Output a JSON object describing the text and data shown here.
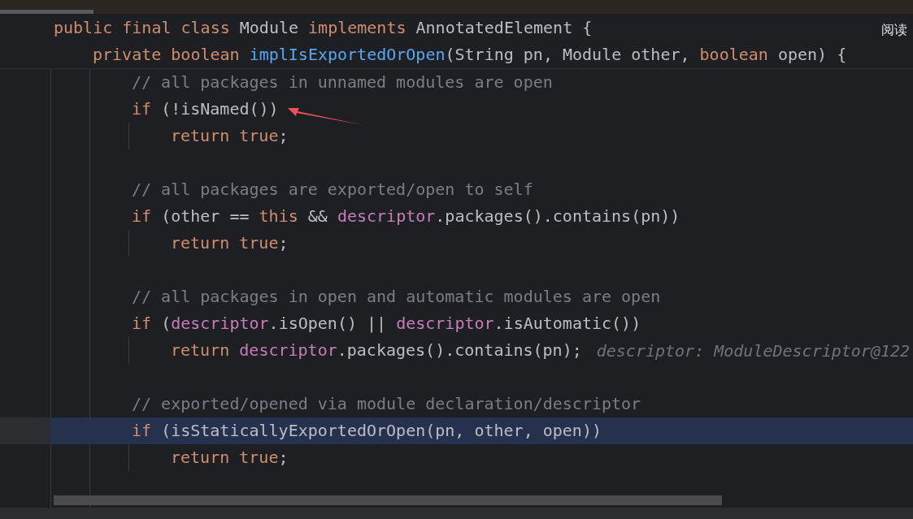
{
  "floating_label": "阅读",
  "sticky_header": [
    {
      "kind": "class",
      "tokens": [
        {
          "kind": "keyword",
          "text": "public final class "
        },
        {
          "kind": "plain",
          "text": "Module "
        },
        {
          "kind": "keyword",
          "text": "implements "
        },
        {
          "kind": "plain",
          "text": "AnnotatedElement {"
        }
      ]
    },
    {
      "kind": "member",
      "tokens": [
        {
          "kind": "keyword",
          "text": "private boolean "
        },
        {
          "kind": "declaration",
          "text": "implIsExportedOrOpen"
        },
        {
          "kind": "plain",
          "text": "(String pn, Module other, "
        },
        {
          "kind": "keyword",
          "text": "boolean "
        },
        {
          "kind": "plain",
          "text": "open) {"
        }
      ]
    }
  ],
  "lines": [
    {
      "highlighted": false,
      "kind": "statement",
      "tokens": [
        {
          "kind": "comment",
          "text": "// all packages in unnamed modules are open"
        }
      ]
    },
    {
      "highlighted": false,
      "kind": "statement",
      "tokens": [
        {
          "kind": "keyword",
          "text": "if "
        },
        {
          "kind": "plain",
          "text": "(!isNamed())"
        }
      ]
    },
    {
      "highlighted": false,
      "kind": "nested",
      "tokens": [
        {
          "kind": "keyword",
          "text": "return true"
        },
        {
          "kind": "plain",
          "text": ";"
        }
      ]
    },
    {
      "highlighted": false,
      "kind": "blank"
    },
    {
      "highlighted": false,
      "kind": "statement",
      "tokens": [
        {
          "kind": "comment",
          "text": "// all packages are exported/open to self"
        }
      ]
    },
    {
      "highlighted": false,
      "kind": "statement",
      "tokens": [
        {
          "kind": "keyword",
          "text": "if "
        },
        {
          "kind": "plain",
          "text": "(other == "
        },
        {
          "kind": "keyword",
          "text": "this "
        },
        {
          "kind": "plain",
          "text": "&& "
        },
        {
          "kind": "field",
          "text": "descriptor"
        },
        {
          "kind": "plain",
          "text": ".packages().contains(pn))"
        }
      ]
    },
    {
      "highlighted": false,
      "kind": "nested",
      "tokens": [
        {
          "kind": "keyword",
          "text": "return true"
        },
        {
          "kind": "plain",
          "text": ";"
        }
      ]
    },
    {
      "highlighted": false,
      "kind": "blank"
    },
    {
      "highlighted": false,
      "kind": "statement",
      "tokens": [
        {
          "kind": "comment",
          "text": "// all packages in open and automatic modules are open"
        }
      ]
    },
    {
      "highlighted": false,
      "kind": "statement",
      "tokens": [
        {
          "kind": "keyword",
          "text": "if "
        },
        {
          "kind": "plain",
          "text": "("
        },
        {
          "kind": "field",
          "text": "descriptor"
        },
        {
          "kind": "plain",
          "text": ".isOpen() || "
        },
        {
          "kind": "field",
          "text": "descriptor"
        },
        {
          "kind": "plain",
          "text": ".isAutomatic())"
        }
      ]
    },
    {
      "highlighted": false,
      "kind": "nested",
      "tokens": [
        {
          "kind": "keyword",
          "text": "return "
        },
        {
          "kind": "field",
          "text": "descriptor"
        },
        {
          "kind": "plain",
          "text": ".packages().contains(pn);"
        }
      ],
      "hint": "descriptor: ModuleDescriptor@122"
    },
    {
      "highlighted": false,
      "kind": "blank"
    },
    {
      "highlighted": false,
      "kind": "statement",
      "tokens": [
        {
          "kind": "comment",
          "text": "// exported/opened via module declaration/descriptor"
        }
      ]
    },
    {
      "highlighted": true,
      "kind": "statement",
      "tokens": [
        {
          "kind": "keyword",
          "text": "if "
        },
        {
          "kind": "plain",
          "text": "(isStaticallyExportedOrOpen(pn, other, open))"
        }
      ]
    },
    {
      "highlighted": false,
      "kind": "nested",
      "tokens": [
        {
          "kind": "keyword",
          "text": "return true"
        },
        {
          "kind": "plain",
          "text": ";"
        }
      ]
    },
    {
      "highlighted": false,
      "kind": "blank"
    }
  ]
}
